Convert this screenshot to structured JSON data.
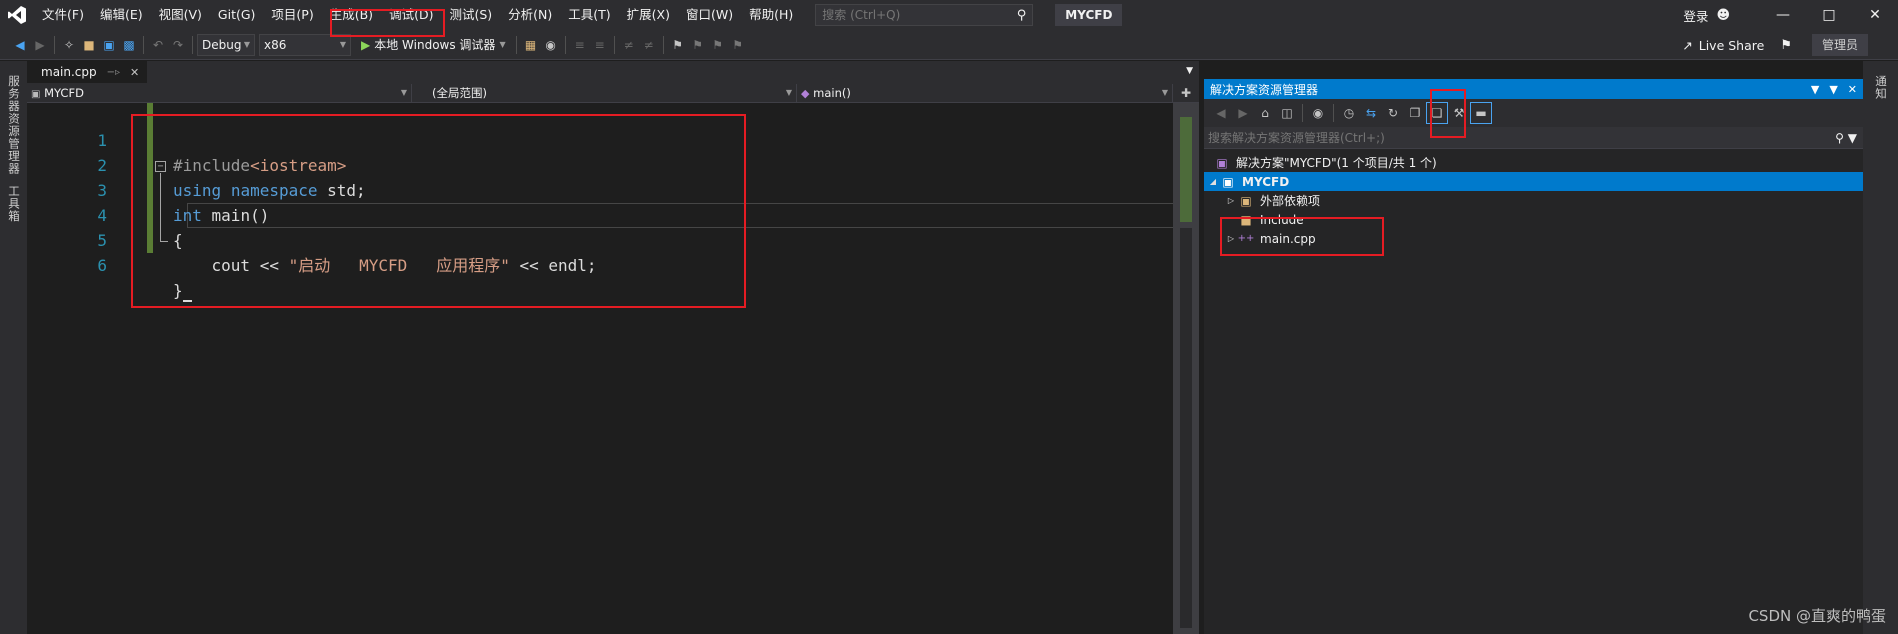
{
  "menu": {
    "items": [
      "文件(F)",
      "编辑(E)",
      "视图(V)",
      "Git(G)",
      "项目(P)",
      "生成(B)",
      "调试(D)",
      "测试(S)",
      "分析(N)",
      "工具(T)",
      "扩展(X)",
      "窗口(W)",
      "帮助(H)"
    ],
    "search_placeholder": "搜索 (Ctrl+Q)",
    "project_badge": "MYCFD",
    "login": "登录"
  },
  "toolbar": {
    "config": "Debug",
    "platform": "x86",
    "run_label": "本地 Windows 调试器",
    "live_share": "Live Share",
    "admin": "管理员"
  },
  "left_strip": {
    "server_explorer": "服务器资源管理器",
    "toolbox": "工具箱"
  },
  "right_strip": {
    "notifications": "通知"
  },
  "editor": {
    "tab_label": "main.cpp",
    "nav_project": "MYCFD",
    "nav_scope": "(全局范围)",
    "nav_function": "main()",
    "line_numbers": [
      "1",
      "2",
      "3",
      "4",
      "5",
      "6"
    ],
    "code": {
      "l1_directive": "#include",
      "l1_header": "<iostream>",
      "l2_using": "using",
      "l2_namespace": "namespace",
      "l2_rest": " std;",
      "l3_int": "int",
      "l3_rest": " main()",
      "l4_brace": "{",
      "l5_cout": "    cout << ",
      "l5_string": "\"启动   MYCFD   应用程序\"",
      "l5_rest": " << endl;",
      "l6_brace": "}"
    }
  },
  "solution_explorer": {
    "title": "解决方案资源管理器",
    "search_placeholder": "搜索解决方案资源管理器(Ctrl+;)",
    "solution_label": "解决方案\"MYCFD\"(1 个项目/共 1 个)",
    "project": "MYCFD",
    "external_deps": "外部依赖项",
    "include_folder": "Include",
    "main_file": "main.cpp"
  },
  "watermark": "CSDN @直爽的鸭蛋",
  "colors": {
    "accent": "#007acc",
    "annotation": "#e51c23",
    "change_bar": "#5a7d34"
  }
}
